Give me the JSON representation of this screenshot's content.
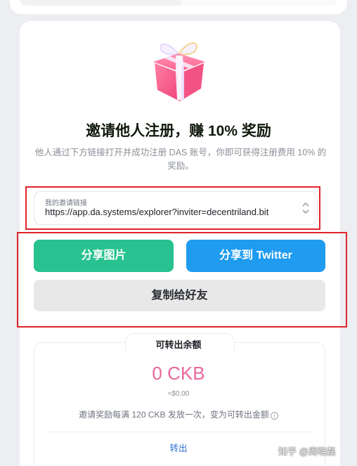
{
  "invite": {
    "title": "邀请他人注册，赚 10% 奖励",
    "description": "他人通过下方链接打开并成功注册 DAS 账号，你即可获得注册费用 10% 的奖励。"
  },
  "link": {
    "label": "我的邀请链接",
    "url": "https://app.da.systems/explorer?inviter=decentriland.bit"
  },
  "actions": {
    "share_image": "分享图片",
    "share_twitter": "分享到 Twitter",
    "copy_to_friend": "复制给好友"
  },
  "balance": {
    "label": "可转出余额",
    "amount": "0 CKB",
    "usd": "≈$0.00",
    "note": "邀请奖励每满 120 CKB 发放一次，变为可转出金额",
    "withdraw": "转出"
  },
  "watermark": "知乎 @周晓磊",
  "colors": {
    "share_image_bg": "#27c290",
    "share_twitter_bg": "#1f9bf0",
    "copy_bg": "#e8e8e8",
    "amount": "#e8689c",
    "highlight_box": "#e0242a"
  }
}
